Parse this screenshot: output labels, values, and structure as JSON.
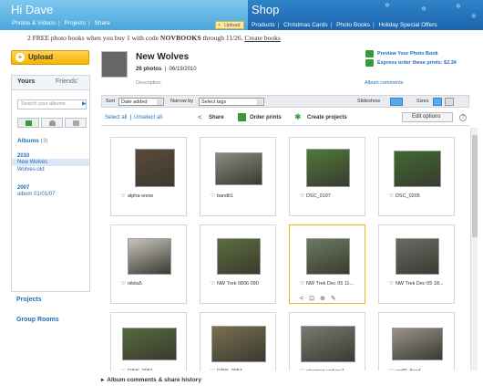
{
  "header": {
    "greeting": "Hi Dave",
    "left_links": [
      "Photos & Videos",
      "Projects",
      "Share"
    ],
    "upload_small": "Upload",
    "shop_title": "Shop",
    "shop_links": [
      "Products",
      "Christmas Cards",
      "Photo Books",
      "Holiday Special Offers"
    ]
  },
  "promo": {
    "text_before": "2 FREE photo books when you buy 1 with code ",
    "code": "NOVBOOKS",
    "text_after": " through 11/26. ",
    "link": "Create books"
  },
  "sidebar": {
    "upload": "Upload",
    "tabs": [
      "Yours",
      "Friends'"
    ],
    "search_placeholder": "Search your albums",
    "albums_label": "Albums",
    "albums_count": "(3)",
    "year_2010": "2010",
    "albums_2010": [
      "New Wolves",
      "Wolves-old"
    ],
    "year_2007": "2007",
    "albums_2007": [
      "album 01/01/07"
    ],
    "projects": "Projects",
    "group_rooms": "Group Rooms"
  },
  "album": {
    "title": "New Wolves",
    "count": "26 photos",
    "date": "06/19/2010",
    "description": "Description",
    "preview_link": "Preview Your Photo Book",
    "express_link": "Express order these prints: $2.34",
    "comments_link": "Album comments"
  },
  "toolbar": {
    "sort_label": "Sort",
    "sort_value": "Date added",
    "narrow_label": "Narrow by",
    "narrow_value": "Select tags",
    "slideshow": "Slideshow",
    "sizes": "Sizes",
    "select_all": "Select all",
    "unselect_all": "Unselect all",
    "share": "Share",
    "order_prints": "Order prints",
    "create_projects": "Create projects",
    "edit_options": "Edit options"
  },
  "photos": [
    {
      "caption": "alpha-snow",
      "color": "#5a4a3a"
    },
    {
      "caption": "bandit1",
      "color": "#8a8a80"
    },
    {
      "caption": "DSC_0197",
      "color": "#4e7a3a"
    },
    {
      "caption": "DSC_0205",
      "color": "#3f6a30"
    },
    {
      "caption": "nikita5",
      "color": "#c8c4bc"
    },
    {
      "caption": "NW Trek 0806 090",
      "color": "#5c6e3e"
    },
    {
      "caption": "NW Trek Dec 05 11...",
      "color": "#6b7c5e"
    },
    {
      "caption": "NW Trek Dec 05 18...",
      "color": "#6c6a66"
    },
    {
      "caption": "RAW_0051",
      "color": "#556a3c"
    },
    {
      "caption": "RAW_0054",
      "color": "#7a7050"
    },
    {
      "caption": "sleeping wolves1",
      "color": "#7c7a70"
    },
    {
      "caption": "wolf2_fixed",
      "color": "#9a9488"
    }
  ],
  "footer": "Album comments & share history"
}
